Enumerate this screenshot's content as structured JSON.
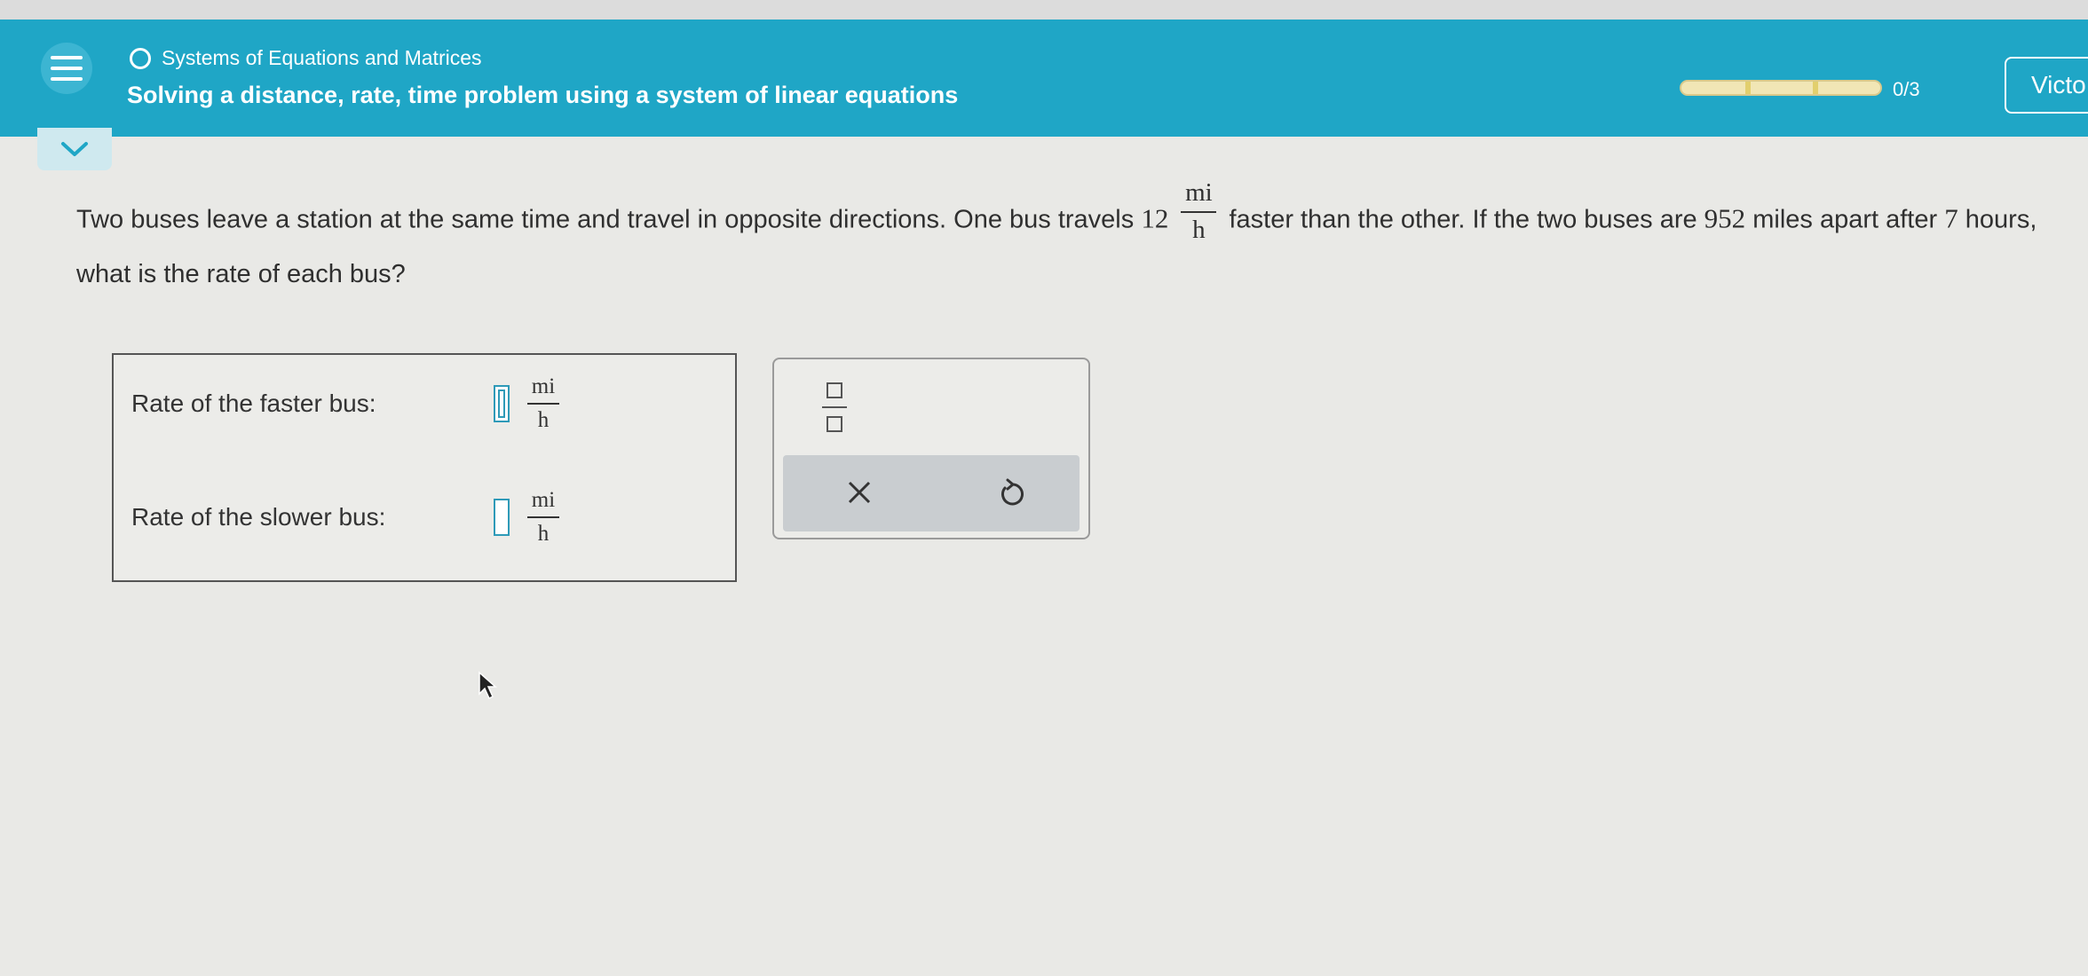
{
  "header": {
    "topic": "Systems of Equations and Matrices",
    "title": "Solving a distance, rate, time problem using a system of linear equations",
    "progress_count": "0/3",
    "progress_fraction": 0,
    "user_button": "Victo"
  },
  "question": {
    "part1": "Two buses leave a station at the same time and travel in opposite directions. One bus travels",
    "speed_diff": "12",
    "unit_num": "mi",
    "unit_den": "h",
    "part2": "faster than the other. If the two buses are",
    "distance": "952",
    "part3": "miles apart after",
    "hours": "7",
    "part4": "hours, what is the rate of each bus?"
  },
  "answers": {
    "faster_label": "Rate of the faster bus:",
    "slower_label": "Rate of the slower bus:",
    "unit_num": "mi",
    "unit_den": "h"
  },
  "tools": {
    "fraction_icon": "fraction-template-icon",
    "clear_icon": "close-icon",
    "undo_icon": "undo-icon"
  },
  "colors": {
    "header_bg": "#1fa6c6",
    "page_bg": "#e9e9e6",
    "progress": "#f1e6b5"
  }
}
